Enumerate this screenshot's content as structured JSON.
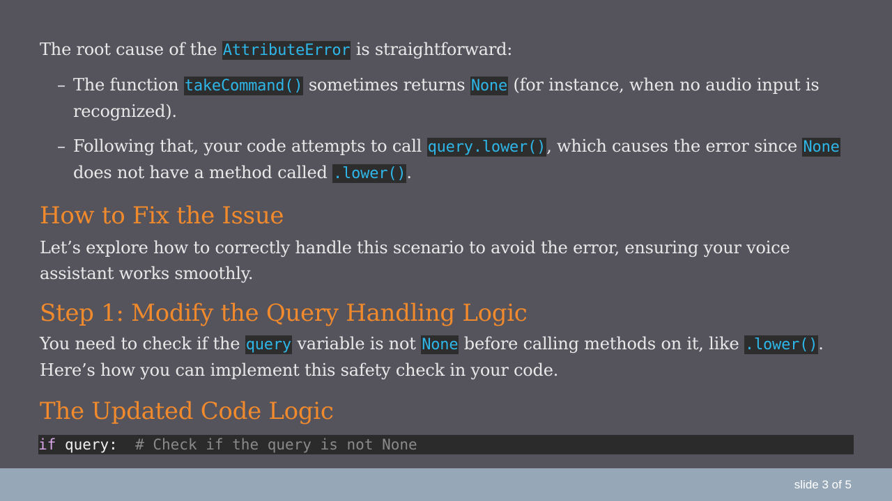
{
  "intro": {
    "before": "The root cause of the ",
    "code": "AttributeError",
    "after": " is straightforward:"
  },
  "bullets": [
    {
      "dash": "–",
      "t1": "The function ",
      "c1": "takeCommand()",
      "t2": " sometimes returns ",
      "c2": "None",
      "t3": " (for instance, when no audio input is recognized)."
    },
    {
      "dash": "–",
      "t1": "Following that, your code attempts to call ",
      "c1": "query.lower()",
      "t2": ", which causes the error since ",
      "c2": "None",
      "t3": " does not have a method called ",
      "c3": ".lower()",
      "t4": "."
    }
  ],
  "fix": {
    "heading": "How to Fix the Issue",
    "text": "Let’s explore how to correctly handle this scenario to avoid the error, ensuring your voice assistant works smoothly."
  },
  "step1": {
    "heading": "Step 1: Modify the Query Handling Logic",
    "t1": "You need to check if the ",
    "c1": "query",
    "t2": " variable is not ",
    "c2": "None",
    "t3": " before calling methods on it, like ",
    "c3": ".lower()",
    "t4": ". Here’s how you can implement this safety check in your code."
  },
  "updated": {
    "heading": "The Updated Code Logic"
  },
  "codeblock": {
    "keyword": "if",
    "rest": " query:  ",
    "comment": "# Check if the query is not None"
  },
  "footer": {
    "counter": "slide 3 of 5"
  }
}
